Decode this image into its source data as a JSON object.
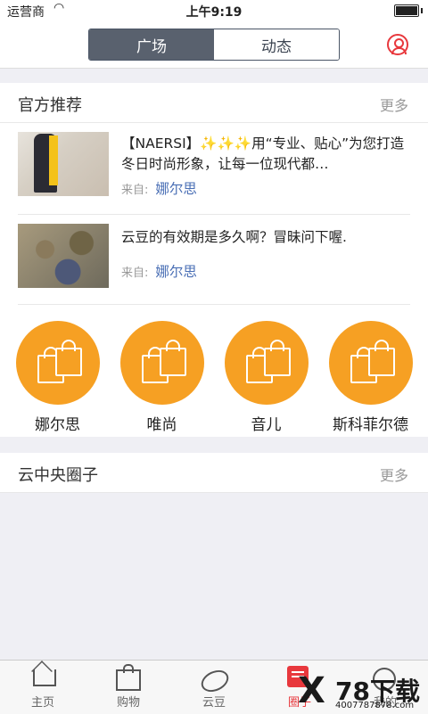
{
  "status": {
    "carrier": "运营商",
    "time": "上午9:19"
  },
  "nav": {
    "tabs": [
      {
        "label": "广场",
        "active": true
      },
      {
        "label": "动态",
        "active": false
      }
    ]
  },
  "recommend": {
    "title": "官方推荐",
    "more": "更多",
    "items": [
      {
        "text": "【NAERSI】✨✨✨用“专业、贴心”为您打造冬日时尚形象，让每一位现代都…",
        "from_label": "来自:",
        "from_name": "娜尔思"
      },
      {
        "text": "云豆的有效期是多久啊？冒昧问下喔.",
        "from_label": "来自:",
        "from_name": "娜尔思"
      }
    ],
    "brands": [
      {
        "name": "娜尔思"
      },
      {
        "name": "唯尚"
      },
      {
        "name": "音儿"
      },
      {
        "name": "斯科菲尔德"
      }
    ]
  },
  "circle": {
    "title": "云中央圈子",
    "more": "更多"
  },
  "tabbar": {
    "items": [
      {
        "label": "主页"
      },
      {
        "label": "购物"
      },
      {
        "label": "云豆"
      },
      {
        "label": "圈子"
      },
      {
        "label": "我的"
      }
    ]
  },
  "watermark": {
    "brand": "78下载",
    "url": "4007787878.com"
  },
  "colors": {
    "accent": "#e8383d",
    "orange": "#f6a023",
    "segment": "#59616e",
    "link": "#4a6fb5"
  }
}
